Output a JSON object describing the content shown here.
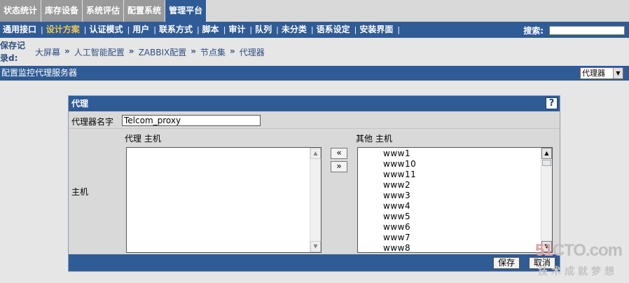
{
  "top_tabs": [
    {
      "label": "状态统计",
      "active": false
    },
    {
      "label": "库存设备",
      "active": false
    },
    {
      "label": "系统评估",
      "active": false
    },
    {
      "label": "配置系统",
      "active": false
    },
    {
      "label": "管理平台",
      "active": true
    }
  ],
  "sub_nav": {
    "items": [
      {
        "label": "通用接口",
        "active": false
      },
      {
        "label": "设计方案",
        "active": true
      },
      {
        "label": "认证模式",
        "active": false
      },
      {
        "label": "用户",
        "active": false
      },
      {
        "label": "联系方式",
        "active": false
      },
      {
        "label": "脚本",
        "active": false
      },
      {
        "label": "审计",
        "active": false
      },
      {
        "label": "队列",
        "active": false
      },
      {
        "label": "未分类",
        "active": false
      },
      {
        "label": "语系设定",
        "active": false
      },
      {
        "label": "安装界面",
        "active": false
      }
    ],
    "separator": "|",
    "search_label": "搜索:",
    "search_value": ""
  },
  "history": {
    "label": "保存记录d:",
    "separator": "»",
    "crumbs": [
      "大屏幕",
      "人工智能配置",
      "ZABBIX配置",
      "节点集",
      "代理器"
    ]
  },
  "page_header": {
    "title": "配置监控代理服务器",
    "select_value": "代理器",
    "select_arrow": "▼"
  },
  "proxy_form": {
    "title": "代理",
    "help_label": "?",
    "name_label": "代理器名字",
    "name_value": "Telcom_proxy",
    "hosts_label": "主机",
    "proxy_hosts_label": "代理 主机",
    "other_hosts_label": "其他 主机",
    "proxy_hosts": [],
    "other_hosts": [
      "www1",
      "www10",
      "www11",
      "www2",
      "www3",
      "www4",
      "www5",
      "www6",
      "www7",
      "www8"
    ],
    "move_left_label": "«",
    "move_right_label": "»",
    "scroll_up": "▲",
    "scroll_down": "▼",
    "save_label": "保存",
    "cancel_label": "取消"
  },
  "watermark": {
    "logo_accent": "51",
    "logo_rest": "CTO.com",
    "slogan": "技术成就梦想"
  },
  "colors": {
    "nav_blue": "#2f5b96",
    "tab_gray": "#9a9a9a",
    "active_sub_nav": "#f2c94c",
    "link_blue": "#2f4f84"
  }
}
